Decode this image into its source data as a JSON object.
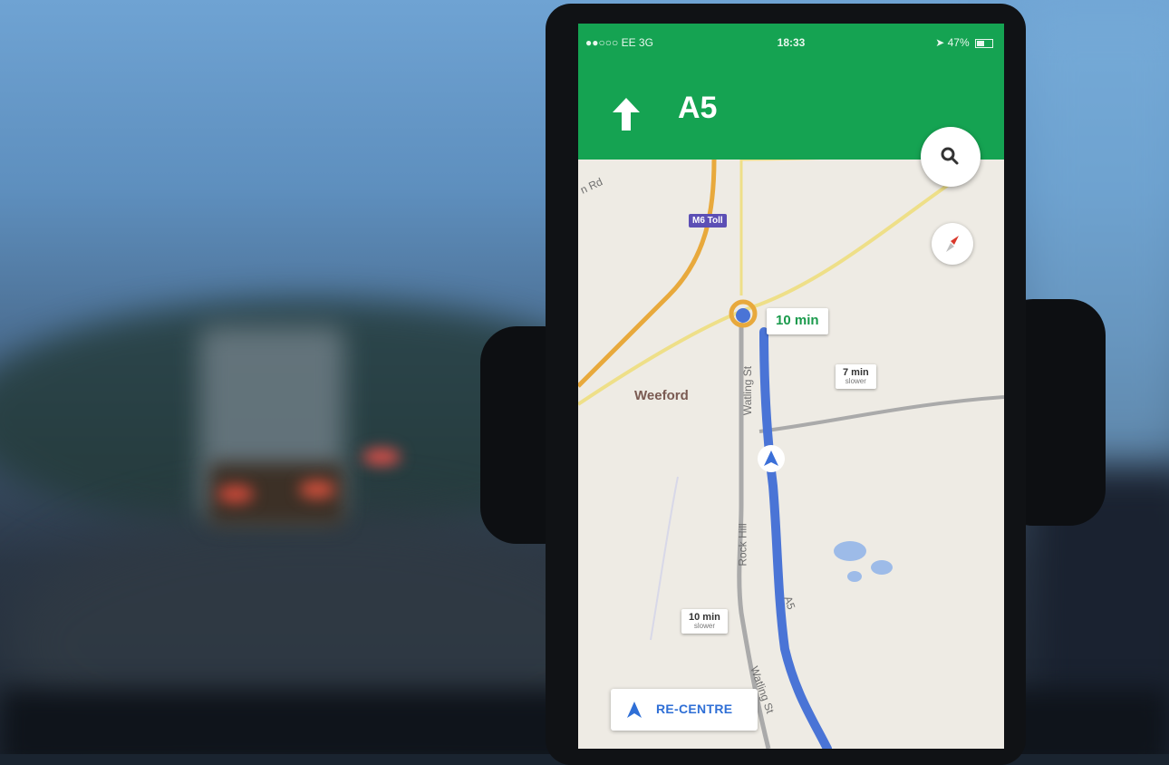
{
  "status_bar": {
    "carrier": "●●○○○ EE  3G",
    "time": "18:33",
    "battery": "47%"
  },
  "navigation": {
    "road_name": "A5",
    "maneuver_icon": "straight-arrow-icon",
    "header_color": "#15a352"
  },
  "map": {
    "place_labels": {
      "weeford": "Weeford",
      "road_partial": "n Rd",
      "watling_upper": "Watling St",
      "rock_hill": "Rock Hill",
      "watling_lower": "Watling St",
      "a5_route": "A5"
    },
    "toll_badge": "M6 Toll",
    "route_color": "#4a74d6",
    "eta_main": {
      "time": "10 min"
    },
    "alt_route_1": {
      "time": "7 min",
      "note": "slower"
    },
    "alt_route_2": {
      "time": "10 min",
      "note": "slower"
    }
  },
  "controls": {
    "search_icon": "search-icon",
    "compass_icon": "compass-icon",
    "recentre_label": "RE-CENTRE"
  }
}
